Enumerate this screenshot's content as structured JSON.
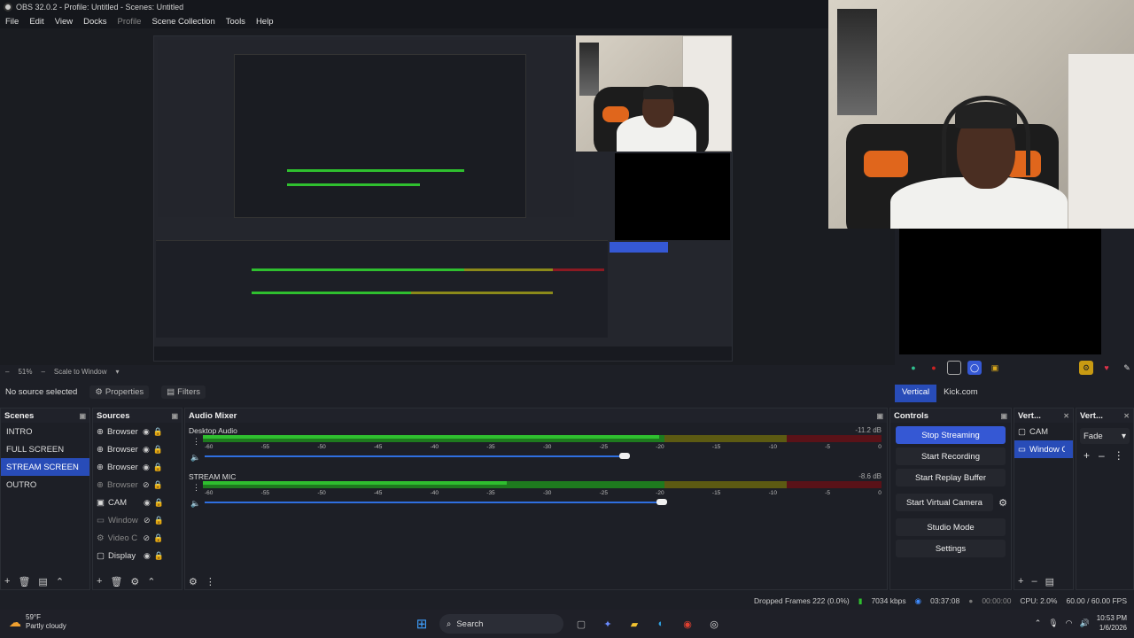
{
  "window": {
    "title": "OBS 32.0.2 - Profile: Untitled - Scenes: Untitled"
  },
  "menu": [
    "File",
    "Edit",
    "View",
    "Docks",
    "Profile",
    "Scene Collection",
    "Tools",
    "Help"
  ],
  "zoom": {
    "value": "51%",
    "mode": "Scale to Window"
  },
  "source_bar": {
    "no_selection": "No source selected",
    "properties": "Properties",
    "filters": "Filters"
  },
  "vertical_tabs": [
    "Vertical",
    "Kick.com"
  ],
  "scenes": {
    "title": "Scenes",
    "items": [
      "INTRO",
      "FULL SCREEN",
      "STREAM SCREEN",
      "OUTRO"
    ],
    "selected": "STREAM SCREEN"
  },
  "sources": {
    "title": "Sources",
    "items": [
      {
        "name": "Browser",
        "icon": "globe-icon",
        "visible": true
      },
      {
        "name": "Browser",
        "icon": "globe-icon",
        "visible": true
      },
      {
        "name": "Browser",
        "icon": "globe-icon",
        "visible": true
      },
      {
        "name": "Browser",
        "icon": "globe-icon",
        "visible": false
      },
      {
        "name": "CAM",
        "icon": "camera-icon",
        "visible": true
      },
      {
        "name": "Window",
        "icon": "window-icon",
        "visible": false
      },
      {
        "name": "Video C",
        "icon": "gear-icon",
        "visible": false
      },
      {
        "name": "Display",
        "icon": "monitor-icon",
        "visible": true
      }
    ]
  },
  "mixer": {
    "title": "Audio Mixer",
    "ticks": [
      "-60",
      "-55",
      "-50",
      "-45",
      "-40",
      "-35",
      "-30",
      "-25",
      "-20",
      "-15",
      "-10",
      "-5",
      "0"
    ],
    "tracks": [
      {
        "name": "Desktop Audio",
        "db": "-11.2 dB",
        "level": 0.68
      },
      {
        "name": "STREAM MIC",
        "db": "-8.6 dB",
        "level": 0.78
      }
    ]
  },
  "controls": {
    "title": "Controls",
    "stop_streaming": "Stop Streaming",
    "start_recording": "Start Recording",
    "start_replay": "Start Replay Buffer",
    "start_virtual": "Start Virtual Camera",
    "studio_mode": "Studio Mode",
    "settings": "Settings"
  },
  "vert_scenes": {
    "title": "Vert...",
    "items": [
      "CAM",
      "Window C"
    ]
  },
  "vert_transitions": {
    "title": "Vert...",
    "value": "Fade"
  },
  "status": {
    "dropped": "Dropped Frames 222 (0.0%)",
    "bitrate": "7034 kbps",
    "stream_time": "03:37:08",
    "rec_time": "00:00:00",
    "cpu": "CPU: 2.0%",
    "fps": "60.00 / 60.00 FPS"
  },
  "taskbar": {
    "temp": "59°F",
    "weather": "Partly cloudy",
    "search": "Search",
    "time": "10:53 PM",
    "date": "1/6/2026"
  },
  "colors": {
    "accent": "#284cb8",
    "button_primary": "#3558d4",
    "meter_green": "#2fbf2f",
    "meter_yellow": "#8c8a1a",
    "meter_red": "#8b1a22"
  }
}
